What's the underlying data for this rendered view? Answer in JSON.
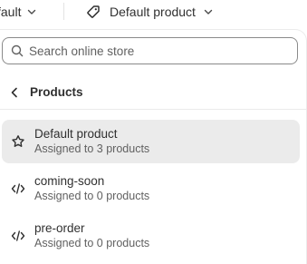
{
  "topbar": {
    "theme_label": "fault",
    "template_label": "Default product"
  },
  "search": {
    "placeholder": "Search online store"
  },
  "navigation": {
    "back_label": "Products"
  },
  "templates": [
    {
      "title": "Default product",
      "subtitle": "Assigned to 3 products",
      "icon": "star-icon",
      "selected": true
    },
    {
      "title": "coming-soon",
      "subtitle": "Assigned to 0 products",
      "icon": "code-icon",
      "selected": false
    },
    {
      "title": "pre-order",
      "subtitle": "Assigned to 0 products",
      "icon": "code-icon",
      "selected": false
    }
  ]
}
